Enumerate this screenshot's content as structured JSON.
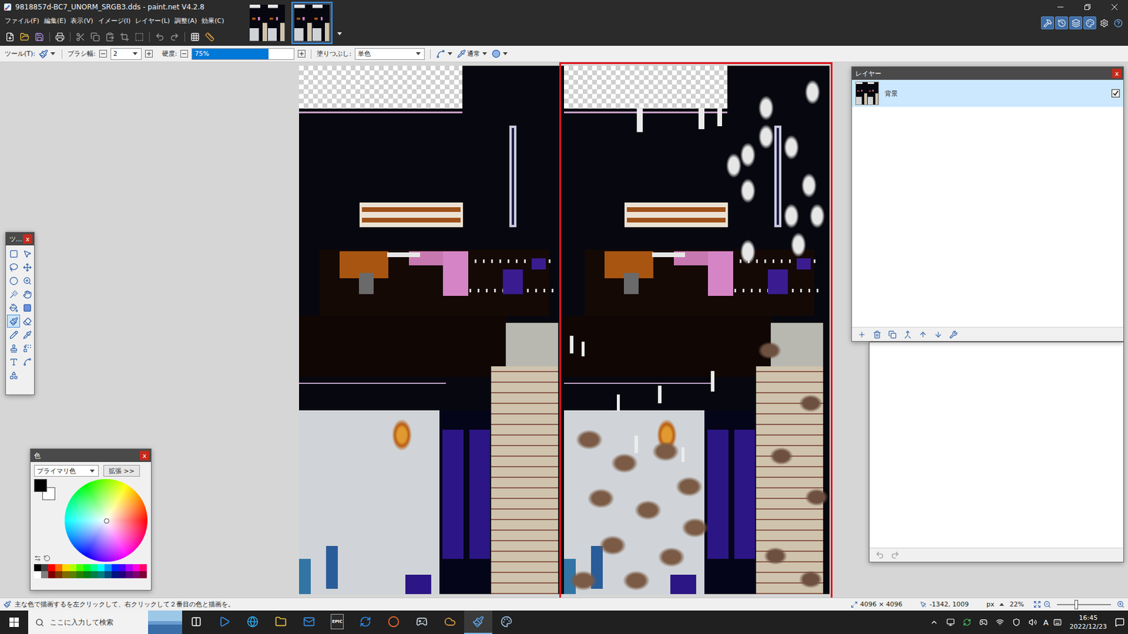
{
  "window": {
    "title": "9818857d-BC7_UNORM_SRGB3.dds - paint.net V4.2.8"
  },
  "menu": [
    "ファイル(F)",
    "編集(E)",
    "表示(V)",
    "イメージ(I)",
    "レイヤー(L)",
    "調整(A)",
    "効果(C)"
  ],
  "image_tabs": [
    {
      "selected": false
    },
    {
      "selected": true
    }
  ],
  "panel_toggles": [
    {
      "selected": true
    },
    {
      "selected": true
    },
    {
      "selected": true
    },
    {
      "selected": true
    }
  ],
  "tool_options": {
    "tool_label": "ツール(T):",
    "brush_width_label": "ブラシ幅:",
    "brush_width": "2",
    "hardness_label": "硬度:",
    "hardness": "75%",
    "hardness_level": 0.75,
    "fill_label": "塗りつぶし:",
    "fill": "単色",
    "blend": "通常"
  },
  "tools_window": {
    "title": "ツ...",
    "close": "x",
    "tools": [
      {
        "selected": false
      },
      {
        "selected": false
      },
      {
        "selected": false
      },
      {
        "selected": false
      },
      {
        "selected": false
      },
      {
        "selected": false
      },
      {
        "selected": false
      },
      {
        "selected": false
      },
      {
        "selected": false
      },
      {
        "selected": false
      },
      {
        "selected": true
      },
      {
        "selected": false
      },
      {
        "selected": false
      },
      {
        "selected": false
      },
      {
        "selected": false
      },
      {
        "selected": false
      },
      {
        "selected": false
      },
      {
        "selected": false
      },
      {
        "selected": false
      }
    ]
  },
  "colors_window": {
    "title": "色",
    "close": "x",
    "mode": "プライマリ色",
    "expand": "拡張 >>",
    "primary": "#000000",
    "secondary": "#ffffff",
    "palette": [
      "#000000",
      "#404040",
      "#ff0000",
      "#ff6a00",
      "#ffd800",
      "#b6ff00",
      "#4cff00",
      "#00ff21",
      "#00ff90",
      "#00ffff",
      "#0094ff",
      "#0026ff",
      "#4800ff",
      "#b200ff",
      "#ff00dc",
      "#ff006e",
      "#ffffff",
      "#808080",
      "#7f0000",
      "#7f3300",
      "#7f6a00",
      "#5b7f00",
      "#267f00",
      "#007f0e",
      "#007f46",
      "#007f7f",
      "#004a7f",
      "#00137f",
      "#21007f",
      "#57007f",
      "#7f006e",
      "#7f0037"
    ]
  },
  "layers_window": {
    "title": "レイヤー",
    "close": "x",
    "layers": [
      {
        "name": "背景",
        "visible": true,
        "selected": true
      }
    ]
  },
  "status_bar": {
    "hint": "主な色で描画するを左クリックして、右クリックして２番目の色と描画を。",
    "image_size": "4096 × 4096",
    "cursor": "-1342, 1009",
    "unit": "px",
    "zoom": "22%",
    "zoom_level": 0.36
  },
  "taskbar": {
    "search_placeholder": "ここに入力して検索",
    "epic_logo": "EPIC",
    "ime": "A",
    "time": "16:45",
    "date": "2022/12/23",
    "apps": [
      {
        "active": false
      },
      {
        "active": false
      },
      {
        "active": false
      },
      {
        "active": false
      },
      {
        "active": false
      },
      {
        "active": false
      },
      {
        "active": false
      },
      {
        "active": false
      },
      {
        "active": false
      },
      {
        "active": true
      },
      {
        "active": false
      }
    ]
  }
}
